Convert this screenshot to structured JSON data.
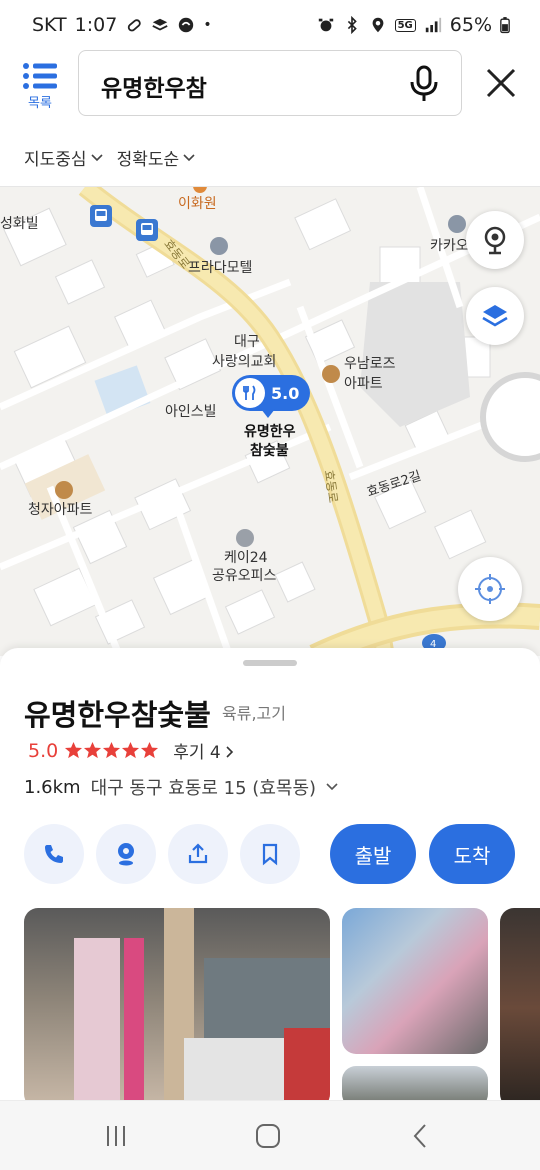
{
  "status_bar": {
    "carrier": "SKT",
    "time": "1:07",
    "battery": "65%",
    "network": "5G"
  },
  "header": {
    "menu_label": "목록",
    "search_value": "유명한우참",
    "filters": [
      "지도중심",
      "정확도순"
    ]
  },
  "map": {
    "labels": {
      "ihwawon": "이화원",
      "seonghwa": "성화빌",
      "prada": "프라다모텔",
      "kakao": "카카오",
      "church_1": "대구",
      "church_2": "사랑의교회",
      "unam_1": "우남로즈",
      "unam_2": "아파트",
      "aince": "아인스빌",
      "pin_name_1": "유명한우",
      "pin_name_2": "참숯불",
      "road_hyodong": "효동로",
      "road_hyodong2": "효동로2길",
      "cheongja": "청자아파트",
      "k24_1": "케이24",
      "k24_2": "공유오피스",
      "route_no": "4"
    },
    "pin_rating": "5.0"
  },
  "place": {
    "name": "유명한우참숯불",
    "category": "육류,고기",
    "rating": "5.0",
    "stars": 5,
    "review_text": "후기 4",
    "distance": "1.6km",
    "address": "대구 동구 효동로 15 (효목동)",
    "actions": {
      "depart_label": "출발",
      "arrive_label": "도착"
    }
  },
  "colors": {
    "accent": "#2b6fe0",
    "rating": "#e8403a"
  }
}
